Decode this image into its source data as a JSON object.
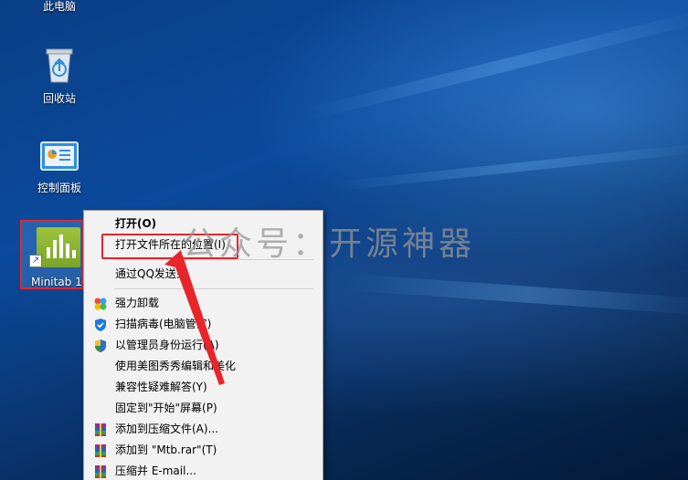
{
  "desktop": {
    "icons": [
      {
        "label": "此电脑",
        "icon": "computer-icon"
      },
      {
        "label": "回收站",
        "icon": "recycle-bin-icon"
      },
      {
        "label": "控制面板",
        "icon": "control-panel-icon"
      },
      {
        "label": "Minitab 1",
        "icon": "minitab-icon"
      }
    ]
  },
  "watermark": "公众号：开源神器",
  "context_menu": {
    "items": [
      {
        "label": "打开(O)",
        "bold": true
      },
      {
        "label": "打开文件所在的位置(I)"
      },
      {
        "label": "通过QQ发送到"
      },
      {
        "label": "强力卸载",
        "icon": "uninstall-icon"
      },
      {
        "label": "扫描病毒(电脑管家)",
        "icon": "shield-scan-icon"
      },
      {
        "label": "以管理员身份运行(A)",
        "icon": "uac-shield-icon"
      },
      {
        "label": "使用美图秀秀编辑和美化"
      },
      {
        "label": "兼容性疑难解答(Y)"
      },
      {
        "label": "固定到\"开始\"屏幕(P)"
      },
      {
        "label": "添加到压缩文件(A)...",
        "icon": "winrar-icon"
      },
      {
        "label": "添加到 \"Mtb.rar\"(T)",
        "icon": "winrar-icon"
      },
      {
        "label": "压缩并 E-mail...",
        "icon": "winrar-icon"
      }
    ]
  },
  "colors": {
    "highlight": "#e8252b",
    "menu_bg": "#f2f2f2"
  }
}
